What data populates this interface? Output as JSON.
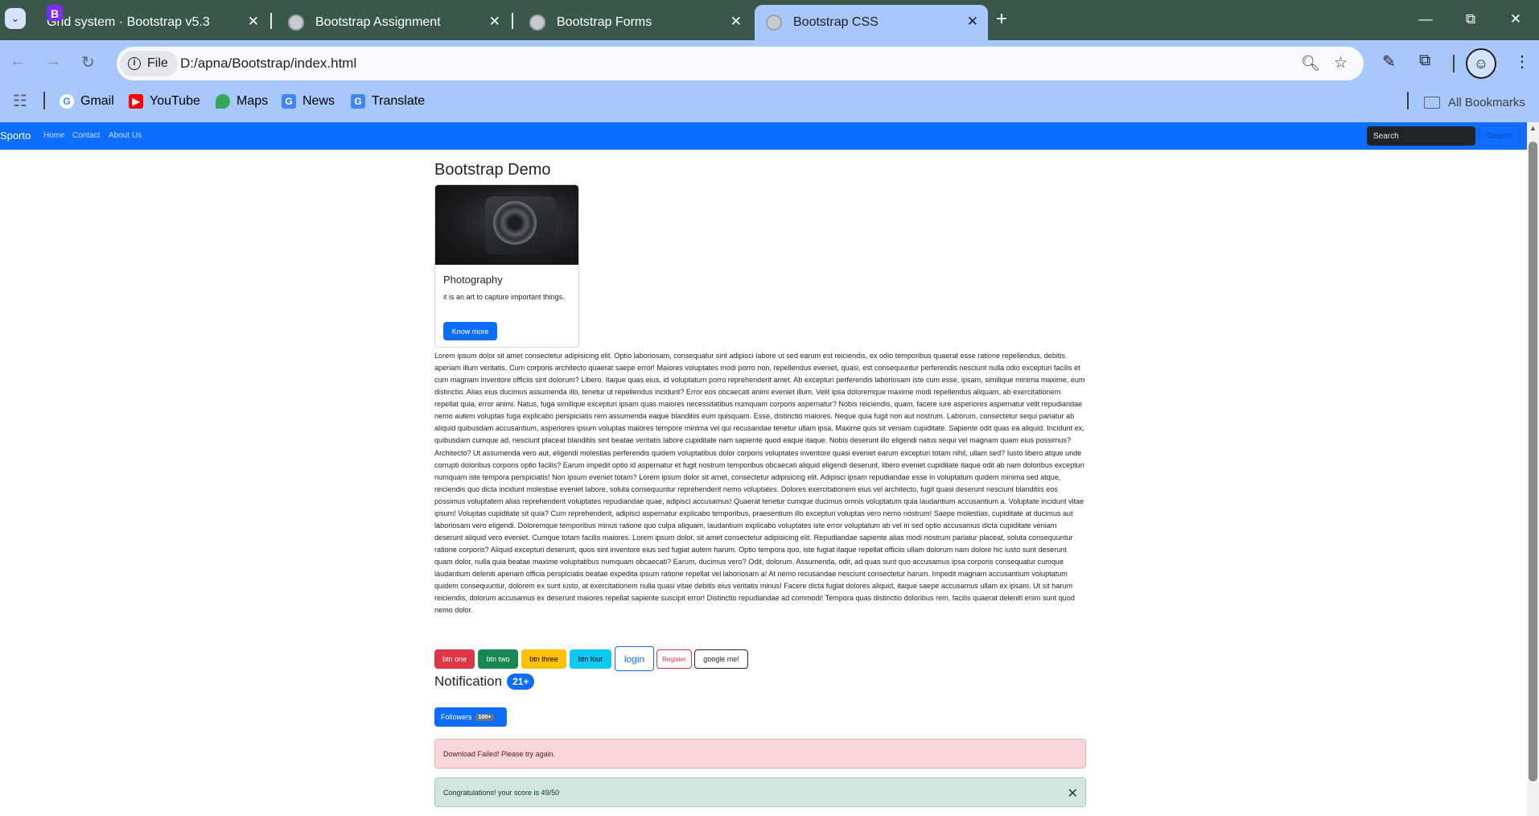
{
  "browser": {
    "tabs": [
      {
        "title": "Grid system · Bootstrap v5.3",
        "icon": "bootstrap-icon",
        "active": false
      },
      {
        "title": "Bootstrap Assignment",
        "icon": "globe-icon",
        "active": false
      },
      {
        "title": "Bootstrap Forms",
        "icon": "globe-icon",
        "active": false
      },
      {
        "title": "Bootstrap CSS",
        "icon": "globe-icon",
        "active": true
      }
    ],
    "address": {
      "scheme_label": "File",
      "url": "D:/apna/Bootstrap/index.html"
    },
    "bookmarks": [
      "Gmail",
      "YouTube",
      "Maps",
      "News",
      "Translate"
    ],
    "all_bookmarks_label": "All Bookmarks",
    "colors": {
      "tabstrip": "#3a584a",
      "toolbar": "#a8c7fa"
    }
  },
  "site": {
    "navbar": {
      "brand": "Sporto",
      "links": [
        "Home",
        "Contact",
        "About Us"
      ],
      "search_placeholder": "Search",
      "search_button": "Search",
      "color": "#0d6efd"
    },
    "title": "Bootstrap Demo",
    "card": {
      "title": "Photography",
      "text": "it is an art to capture important things.",
      "button": "Know more",
      "image": "camera-photo"
    },
    "lorem": "Lorem ipsum dolor sit amet consectetur adipisicing elit. Optio laboriosam, consequatur sint adipisci labore ut sed earum est reiciendis, ex odio temporibus quaerat esse ratione repellendus, debitis aperiam illum veritatis. Cum corporis architecto quaerat saepe error! Maiores voluptates modi porro non, repellendus eveniet, quasi, est consequuntur perferendis nesciunt nulla odio excepturi facilis et cum magnam inventore officiis sint dolorum? Libero. Itaque quas eius, id voluptatum porro reprehenderit amet. Ab excepturi perferendis laboriosam iste cum esse, ipsam, similique minima maxime, eum distinctio. Alias eius ducimus assumenda illo, tenetur ut repellendus incidunt? Error eos obcaecati animi eveniet illum. Velit ipsa doloremque maxime modi repellendus aliquam, ab exercitationem repellat quia, error animi. Natus, fuga similique excepturi ipsam quas maiores necessitatibus numquam corporis aspernatur? Nobis reiciendis, quam, facere iure asperiores aspernatur velit repudiandae nemo autem voluptas fuga explicabo perspiciatis rem assumenda eaque blanditiis eum quisquam. Esse, distinctio maiores. Neque quia fugit non aut nostrum. Laborum, consectetur sequi pariatur ab aliquid quibusdam accusantium, asperiores ipsum voluptas maiores tempore minima vel qui recusandae tenetur ullam ipsa. Maxime quis sit veniam cupiditate. Sapiente odit quas ea aliquid. Incidunt ex, quibusdam cumque ad, nesciunt placeat blanditiis sint beatae veritatis labore cupiditate nam sapiente quod eaque itaque. Nobis deserunt illo eligendi natus sequi vel magnam quam eius possimus? Architecto? Ut assumenda vero aut, eligendi molestias perferendis quidem voluptatibus dolor corporis voluptates inventore quasi eveniet earum excepturi totam nihil, ullam sed? Iusto libero atque unde corrupti doloribus corporis optio facilis? Earum impedit optio id aspernatur et fugit nostrum temporibus obcaecati aliquid eligendi deserunt, libero eveniet cupiditate itaque odit ab nam doloribus excepturi numquam iste tempora perspiciatis! Non ipsum eveniet totam? Lorem ipsum dolor sit amet, consectetur adipisicing elit. Adipisci ipsam repudiandae esse in voluptatum quidem minima sed atque, reiciendis quo dicta incidunt molestiae eveniet labore, soluta consequuntur reprehenderit nemo voluptates. Dolores exercitationem eius vel architecto, fugit quasi deserunt nesciunt blanditiis eos possimus voluptatem alias reprehenderit voluptates repudiandae quae, adipisci accusamus! Quaerat tenetur cumque ducimus omnis voluptatum quia laudantium accusantium a. Voluptate incidunt vitae ipsum! Voluptas cupiditate sit quia? Cum reprehenderit, adipisci aspernatur explicabo temporibus, praesentium illo excepturi voluptas vero nemo nostrum! Saepe molestias, cupiditate at ducimus aut laboriosam vero eligendi. Doloremque temporibus minus ratione quo culpa aliquam, laudantium explicabo voluptates iste error voluptatum ab vel in sed optio accusamus dicta cupiditate veniam deserunt aliquid vero eveniet. Cumque totam facilis maiores. Lorem ipsum dolor, sit amet consectetur adipisicing elit. Repudiandae sapiente alias modi nostrum pariatur placeat, soluta consequuntur ratione corporis? Aliquid excepturi deserunt, quos sint inventore eius sed fugiat autem harum. Optio tempora quo, iste fugiat itaque repellat officiis ullam dolorum nam dolore hic iusto sunt deserunt quam dolor, nulla quia beatae maxime voluptatibus numquam obcaecati? Earum, ducimus vero? Odit, dolorum. Assumenda, odit, ad quas sunt quo accusamus ipsa corporis consequatur cumque laudantium deleniti aperiam officia perspiciatis beatae expedita ipsum ratione repellat vel laboriosam a! At nemo recusandae nesciunt consectetur harum. Impedit magnam accusantium voluptatum quidem consequuntur, dolorem ex sunt iusto, at exercitationem nulla quasi vitae debitis eius veritatis minus! Facere dicta fugiat dolores aliquid, itaque saepe accusamus ullam ex ipsam. Ut sit harum reiciendis, dolorum accusamus ex deserunt maiores repellat sapiente suscipit error! Distinctio repudiandae ad commodi! Tempora quas distinctio doloribus rem, facilis quaerat deleniti enim sunt quod nemo dolor.",
    "buttons": {
      "one": "btn one",
      "two": "btn two",
      "three": "btn three",
      "four": "btn four",
      "login": "login",
      "register": "Register",
      "google": "google me!"
    },
    "notification": {
      "label": "Notification",
      "badge": "21+"
    },
    "followers": {
      "label": "Followers",
      "badge": "100+"
    },
    "alerts": {
      "danger": "Download Failed! Please try again.",
      "success": "Congratulations! your score is 49/50"
    }
  }
}
